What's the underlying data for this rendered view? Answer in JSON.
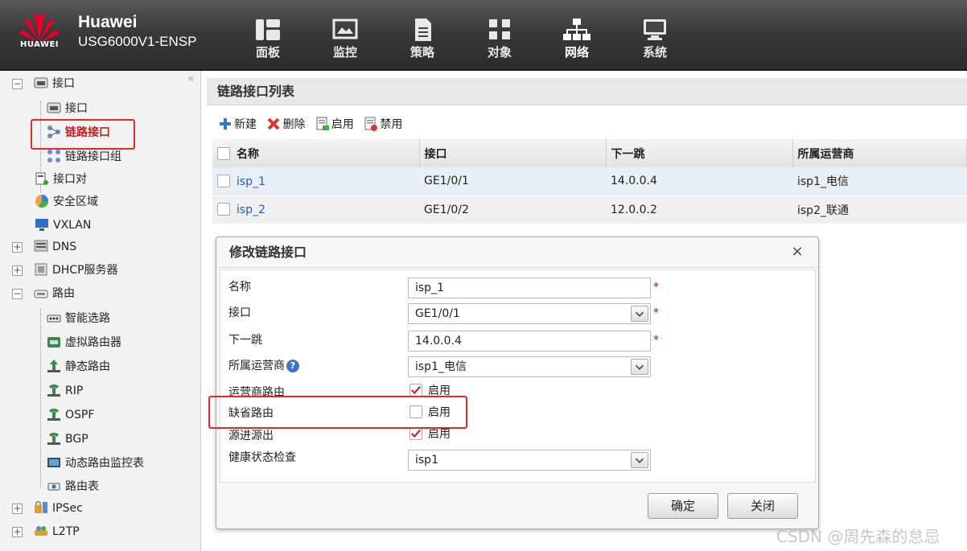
{
  "header": {
    "logo_text": "HUAWEI",
    "brand_name": "Huawei",
    "model": "USG6000V1-ENSP",
    "nav": [
      {
        "label": "面板",
        "icon": "dashboard-icon"
      },
      {
        "label": "监控",
        "icon": "monitor-icon"
      },
      {
        "label": "策略",
        "icon": "policy-icon"
      },
      {
        "label": "对象",
        "icon": "object-icon"
      },
      {
        "label": "网络",
        "icon": "network-icon",
        "active": true
      },
      {
        "label": "系统",
        "icon": "system-icon"
      }
    ]
  },
  "sidebar": {
    "collapse_glyph": "«",
    "items": [
      {
        "label": "接口",
        "toggle": "−"
      },
      {
        "label": "接口"
      },
      {
        "label": "链路接口",
        "selected": true
      },
      {
        "label": "链路接口组"
      },
      {
        "label": "接口对"
      },
      {
        "label": "安全区域"
      },
      {
        "label": "VXLAN"
      },
      {
        "label": "DNS",
        "toggle": "+"
      },
      {
        "label": "DHCP服务器",
        "toggle": "+"
      },
      {
        "label": "路由",
        "toggle": "−"
      },
      {
        "label": "智能选路"
      },
      {
        "label": "虚拟路由器"
      },
      {
        "label": "静态路由"
      },
      {
        "label": "RIP"
      },
      {
        "label": "OSPF"
      },
      {
        "label": "BGP"
      },
      {
        "label": "动态路由监控表"
      },
      {
        "label": "路由表"
      },
      {
        "label": "IPSec",
        "toggle": "+"
      },
      {
        "label": "L2TP",
        "toggle": "+"
      }
    ]
  },
  "main": {
    "title": "链路接口列表",
    "toolbar": {
      "new": "新建",
      "delete": "删除",
      "enable": "启用",
      "disable": "禁用"
    },
    "table": {
      "columns": [
        "名称",
        "接口",
        "下一跳",
        "所属运营商"
      ],
      "rows": [
        {
          "name": "isp_1",
          "interface": "GE1/0/1",
          "next_hop": "14.0.0.4",
          "isp": "isp1_电信"
        },
        {
          "name": "isp_2",
          "interface": "GE1/0/2",
          "next_hop": "12.0.0.2",
          "isp": "isp2_联通"
        }
      ]
    }
  },
  "dialog": {
    "title": "修改链路接口",
    "close_glyph": "×",
    "fields": {
      "name_label": "名称",
      "name_value": "isp_1",
      "interface_label": "接口",
      "interface_value": "GE1/0/1",
      "nexthop_label": "下一跳",
      "nexthop_value": "14.0.0.4",
      "isp_label": "所属运营商",
      "isp_value": "isp1_电信",
      "isp_route_label": "运营商路由",
      "isp_route_check": "启用",
      "isp_route_checked": true,
      "default_route_label": "缺省路由",
      "default_route_check": "启用",
      "default_route_checked": false,
      "src_label": "源进源出",
      "src_check": "启用",
      "src_checked": true,
      "health_label": "健康状态检查",
      "health_value": "isp1"
    },
    "required_mark": "*",
    "help_glyph": "?",
    "ok_label": "确定",
    "close_label": "关闭"
  },
  "watermark": "CSDN @周先森的怠忌",
  "colors": {
    "highlight": "#e32a2a",
    "link": "#1a5fb4",
    "check": "#c0282d"
  }
}
